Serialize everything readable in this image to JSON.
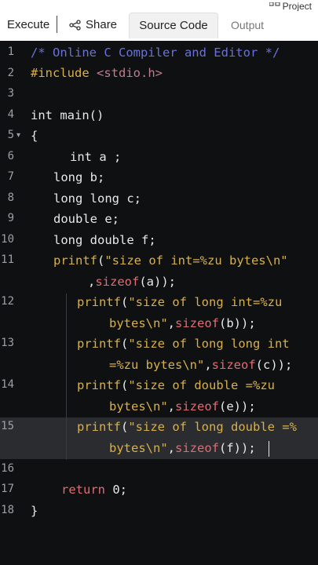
{
  "toolbar": {
    "execute_label": "Execute",
    "share_label": "Share",
    "tabs": [
      {
        "label": "Source Code",
        "active": true
      },
      {
        "label": "Output",
        "active": false
      }
    ],
    "project_label": "Project"
  },
  "editor": {
    "line_numbers": [
      "1",
      "2",
      "3",
      "4",
      "5",
      "6",
      "7",
      "8",
      "9",
      "10",
      "11",
      "",
      "12",
      "",
      "13",
      "",
      "14",
      "",
      "15",
      "",
      "16",
      "17",
      "18"
    ],
    "active_line": "15",
    "code": {
      "l1": "/* Online C Compiler and Editor */",
      "l2_directive": "#include",
      "l2_header": "<stdio.h>",
      "l4": "int main()",
      "l5": "{",
      "l6": "int a ;",
      "l7": "long b;",
      "l8": "long long c;",
      "l9": "double e;",
      "l10": "long double f;",
      "l11_fn": "printf",
      "l11_open": "(",
      "l11_str": "\"size of int=%zu bytes\\n\"",
      "l11b_lead": ",",
      "l11b_fn": "sizeof",
      "l11b_rest": "(a));",
      "l12_fn": "printf",
      "l12_open": "(",
      "l12_str": "\"size of long int=%zu",
      "l12b_str": "bytes\\n\"",
      "l12b_comma": ",",
      "l12b_fn": "sizeof",
      "l12b_rest": "(b));",
      "l13_fn": "printf",
      "l13_open": "(",
      "l13_str": "\"size of long long int",
      "l13b_str": "=%zu bytes\\n\"",
      "l13b_comma": ",",
      "l13b_fn": "sizeof",
      "l13b_rest": "(c));",
      "l14_fn": "printf",
      "l14_open": "(",
      "l14_str": "\"size of double =%zu",
      "l14b_str": "bytes\\n\"",
      "l14b_comma": ",",
      "l14b_fn": "sizeof",
      "l14b_rest": "(e));",
      "l15_fn": "printf",
      "l15_open": "(",
      "l15_str": "\"size of long double =%",
      "l15b_str": "bytes\\n\"",
      "l15b_comma": ",",
      "l15b_fn": "sizeof",
      "l15b_rest": "(f));",
      "l17_kw": "return",
      "l17_rest": " 0;",
      "l18": "}"
    }
  },
  "colors": {
    "background": "#0f1012",
    "active_line": "#2b2c2f",
    "comment": "#6a72d8",
    "string": "#d7b04a",
    "keyword": "#e06c75"
  }
}
